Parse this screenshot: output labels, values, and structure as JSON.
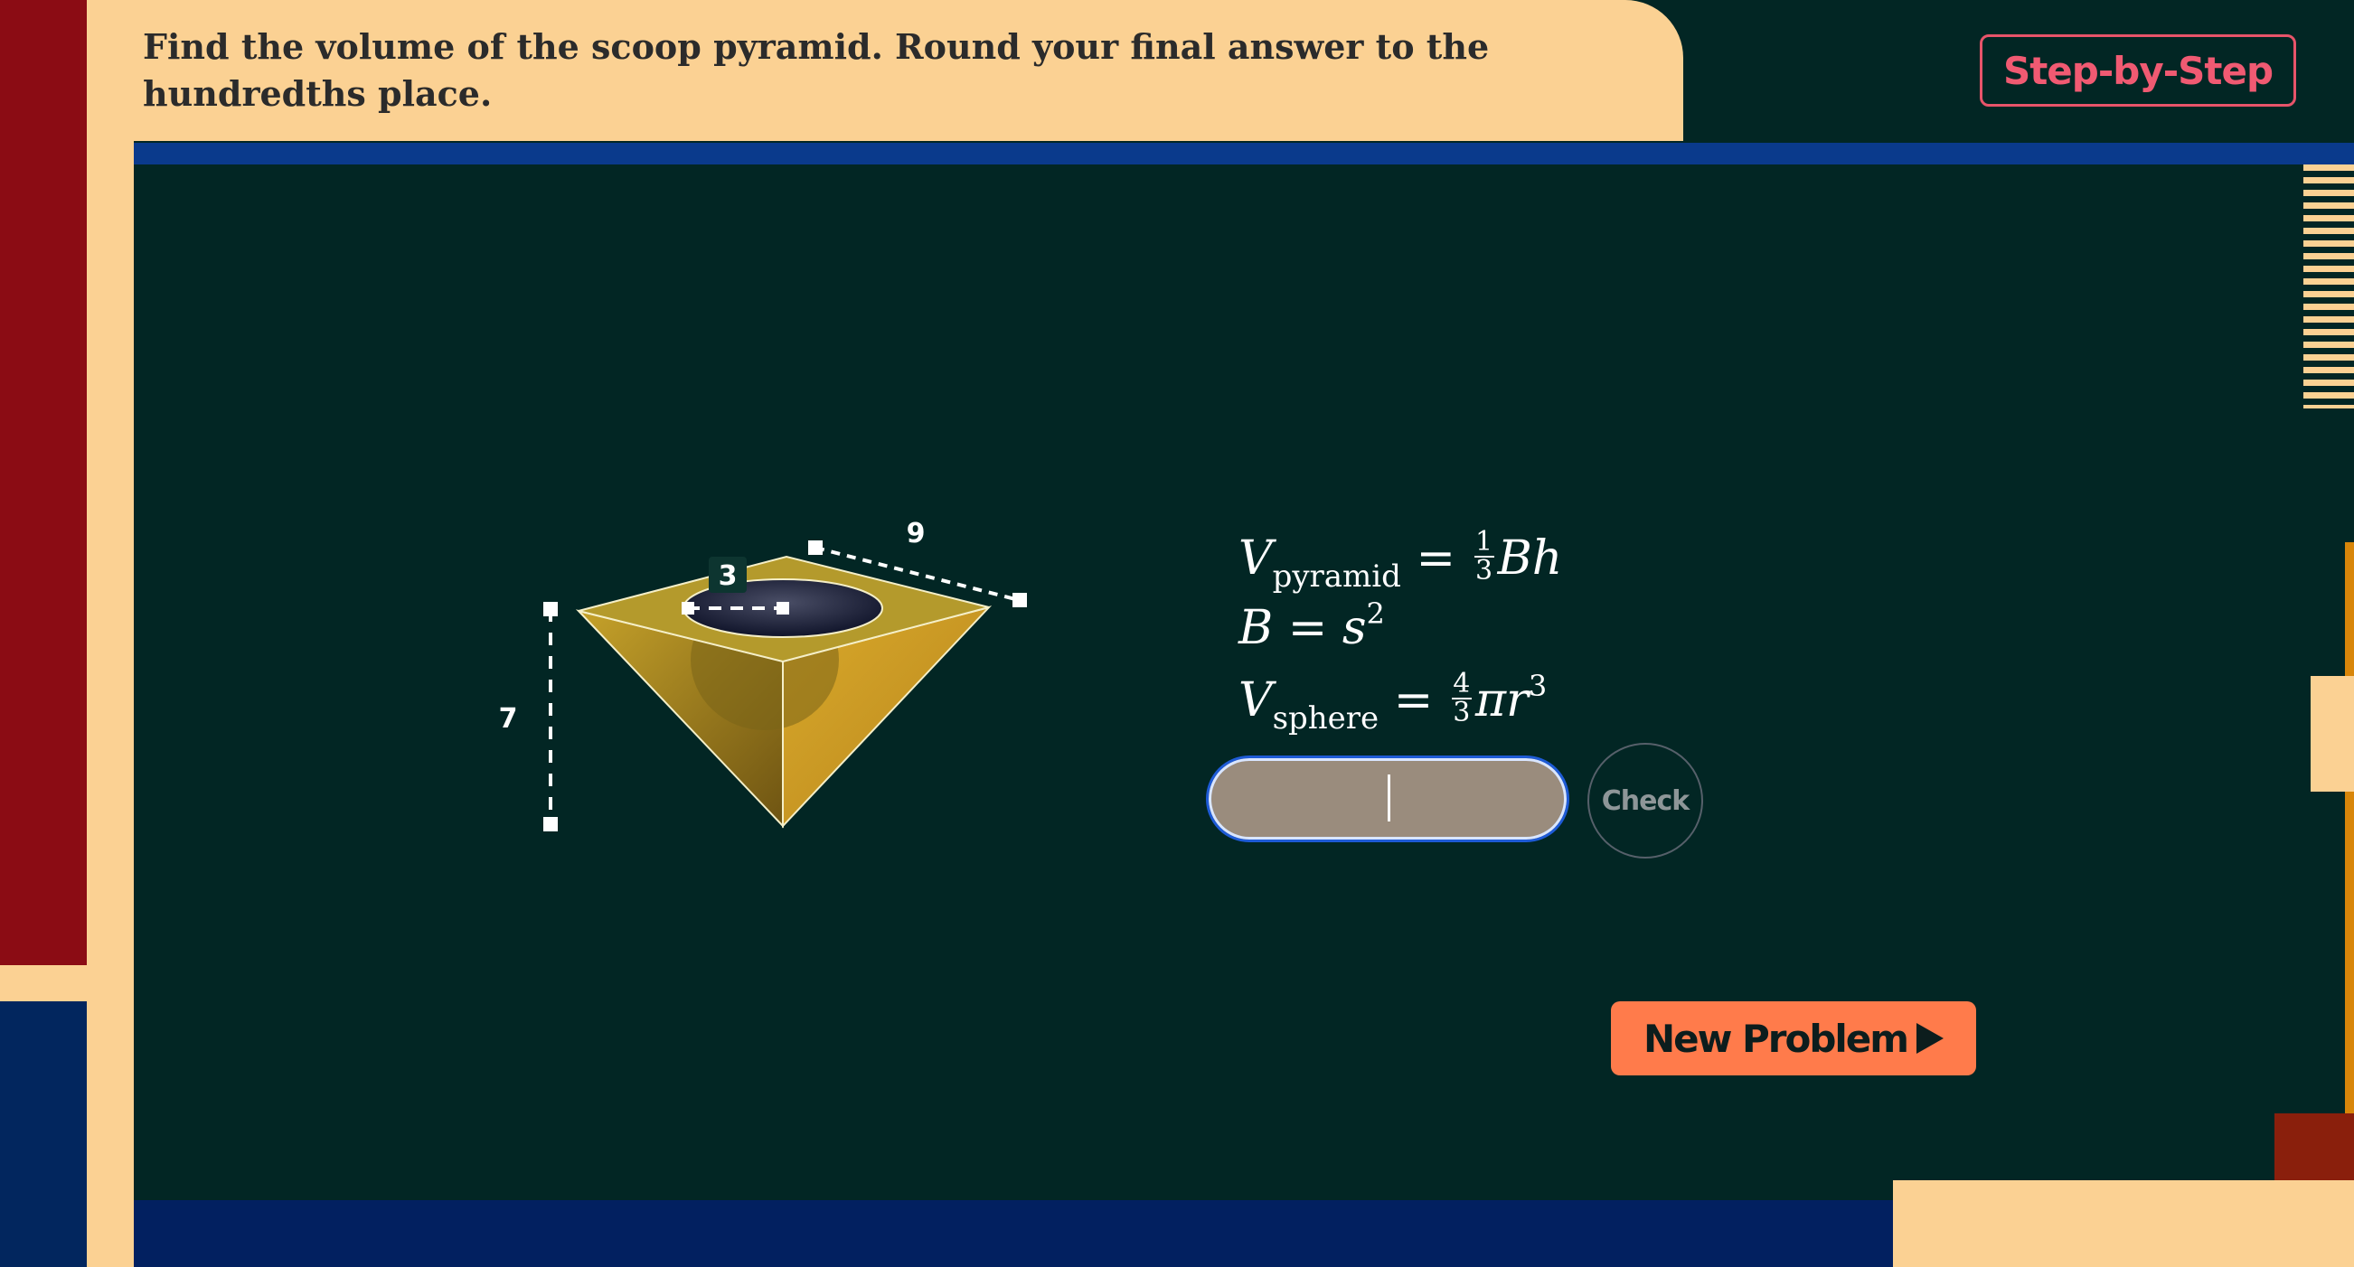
{
  "question": {
    "text": "Find the volume of the scoop pyramid. Round your final answer to the hundredths place."
  },
  "step_by_step": {
    "label": "Step-by-Step"
  },
  "figure": {
    "labels": {
      "radius": "3",
      "side": "9",
      "height": "7"
    }
  },
  "formulas": {
    "pyramid": {
      "lhs": "V",
      "sub": "pyramid",
      "num": "1",
      "den": "3",
      "rhs": "Bh"
    },
    "base": {
      "lhs": "B",
      "rhs": "s",
      "exp": "2"
    },
    "sphere": {
      "lhs": "V",
      "sub": "sphere",
      "num": "4",
      "den": "3",
      "rhs": "πr",
      "exp": "3"
    }
  },
  "answer": {
    "value": "",
    "placeholder": ""
  },
  "check": {
    "label": "Check"
  },
  "new_problem": {
    "label": "New Problem"
  },
  "colors": {
    "board": "#022624",
    "panel": "#fbd193",
    "accent_pink": "#f05a72",
    "new_problem_bg": "#ff7b4b",
    "pyramid_gold": "#c9a028",
    "input_border": "#1e5bd6"
  },
  "icons": {
    "new_problem": "play-icon"
  }
}
